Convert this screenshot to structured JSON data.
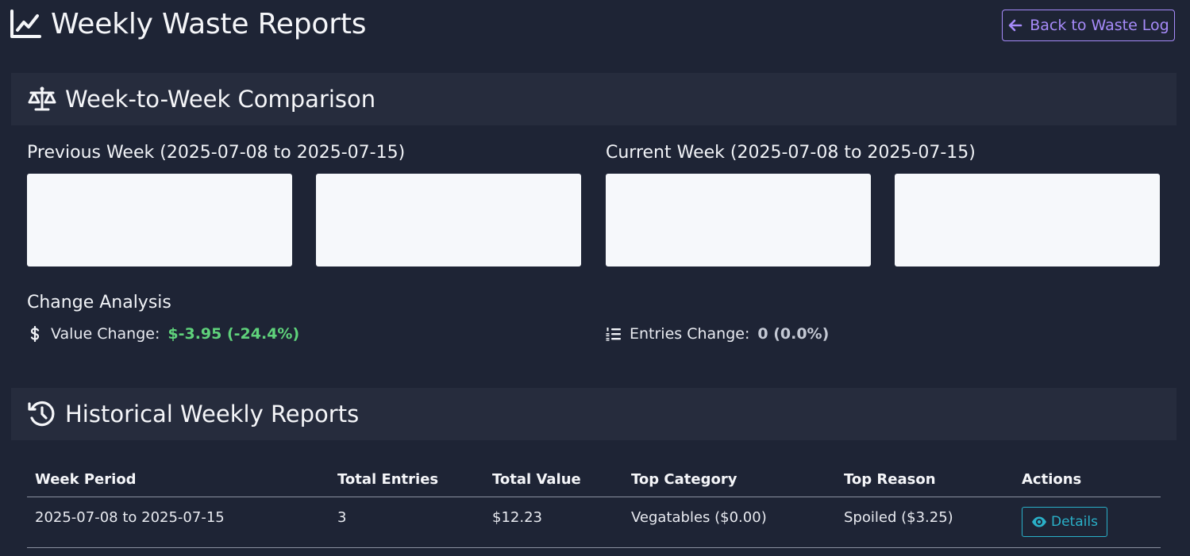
{
  "header": {
    "title": "Weekly Waste Reports",
    "back_button": "Back to Waste Log"
  },
  "comparison": {
    "title": "Week-to-Week Comparison",
    "previous_week_title": "Previous Week (2025-07-08 to 2025-07-15)",
    "current_week_title": "Current Week (2025-07-08 to 2025-07-15)",
    "change_title": "Change Analysis",
    "value_change_label": "Value Change:",
    "value_change_value": "$-3.95 (-24.4%)",
    "entries_change_label": "Entries Change:",
    "entries_change_value": "0 (0.0%)"
  },
  "history": {
    "title": "Historical Weekly Reports",
    "columns": [
      "Week Period",
      "Total Entries",
      "Total Value",
      "Top Category",
      "Top Reason",
      "Actions"
    ],
    "rows": [
      {
        "week_period": "2025-07-08 to 2025-07-15",
        "total_entries": "3",
        "total_value": "$12.23",
        "top_category": "Vegatables ($0.00)",
        "top_reason": "Spoiled ($3.25)",
        "action_label": "Details"
      }
    ]
  },
  "colors": {
    "background": "#1e2435",
    "card_header": "#262c3d",
    "accent_purple": "#a78bfa",
    "accent_cyan": "#2ab0c8",
    "positive_green": "#5fd27b"
  }
}
